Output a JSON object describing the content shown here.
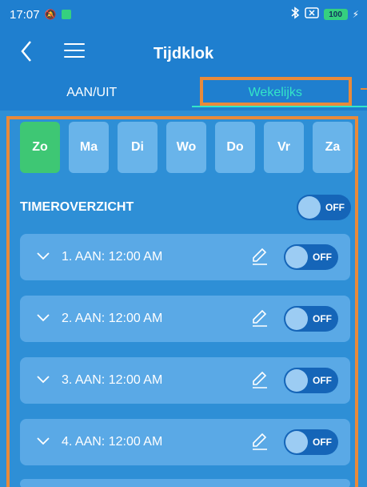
{
  "status_bar": {
    "time": "17:07",
    "battery": "100"
  },
  "app_bar": {
    "title": "Tijdklok"
  },
  "tabs": [
    {
      "label": "AAN/UIT"
    },
    {
      "label": "Wekelijks"
    }
  ],
  "days": [
    "Zo",
    "Ma",
    "Di",
    "Wo",
    "Do",
    "Vr",
    "Za"
  ],
  "selected_day": "Zo",
  "overview": {
    "label": "TIMEROVERZICHT",
    "toggle": "OFF"
  },
  "timers": [
    {
      "label": "1. AAN: 12:00 AM",
      "toggle": "OFF"
    },
    {
      "label": "2. AAN: 12:00 AM",
      "toggle": "OFF"
    },
    {
      "label": "3. AAN: 12:00 AM",
      "toggle": "OFF"
    },
    {
      "label": "4. AAN: 12:00 AM",
      "toggle": "OFF"
    }
  ],
  "colors": {
    "background": "#2e8fd6",
    "header": "#1f7fcf",
    "accent": "#33e6c8",
    "selected_day": "#3ec774",
    "highlight_box": "#e98a3a"
  }
}
